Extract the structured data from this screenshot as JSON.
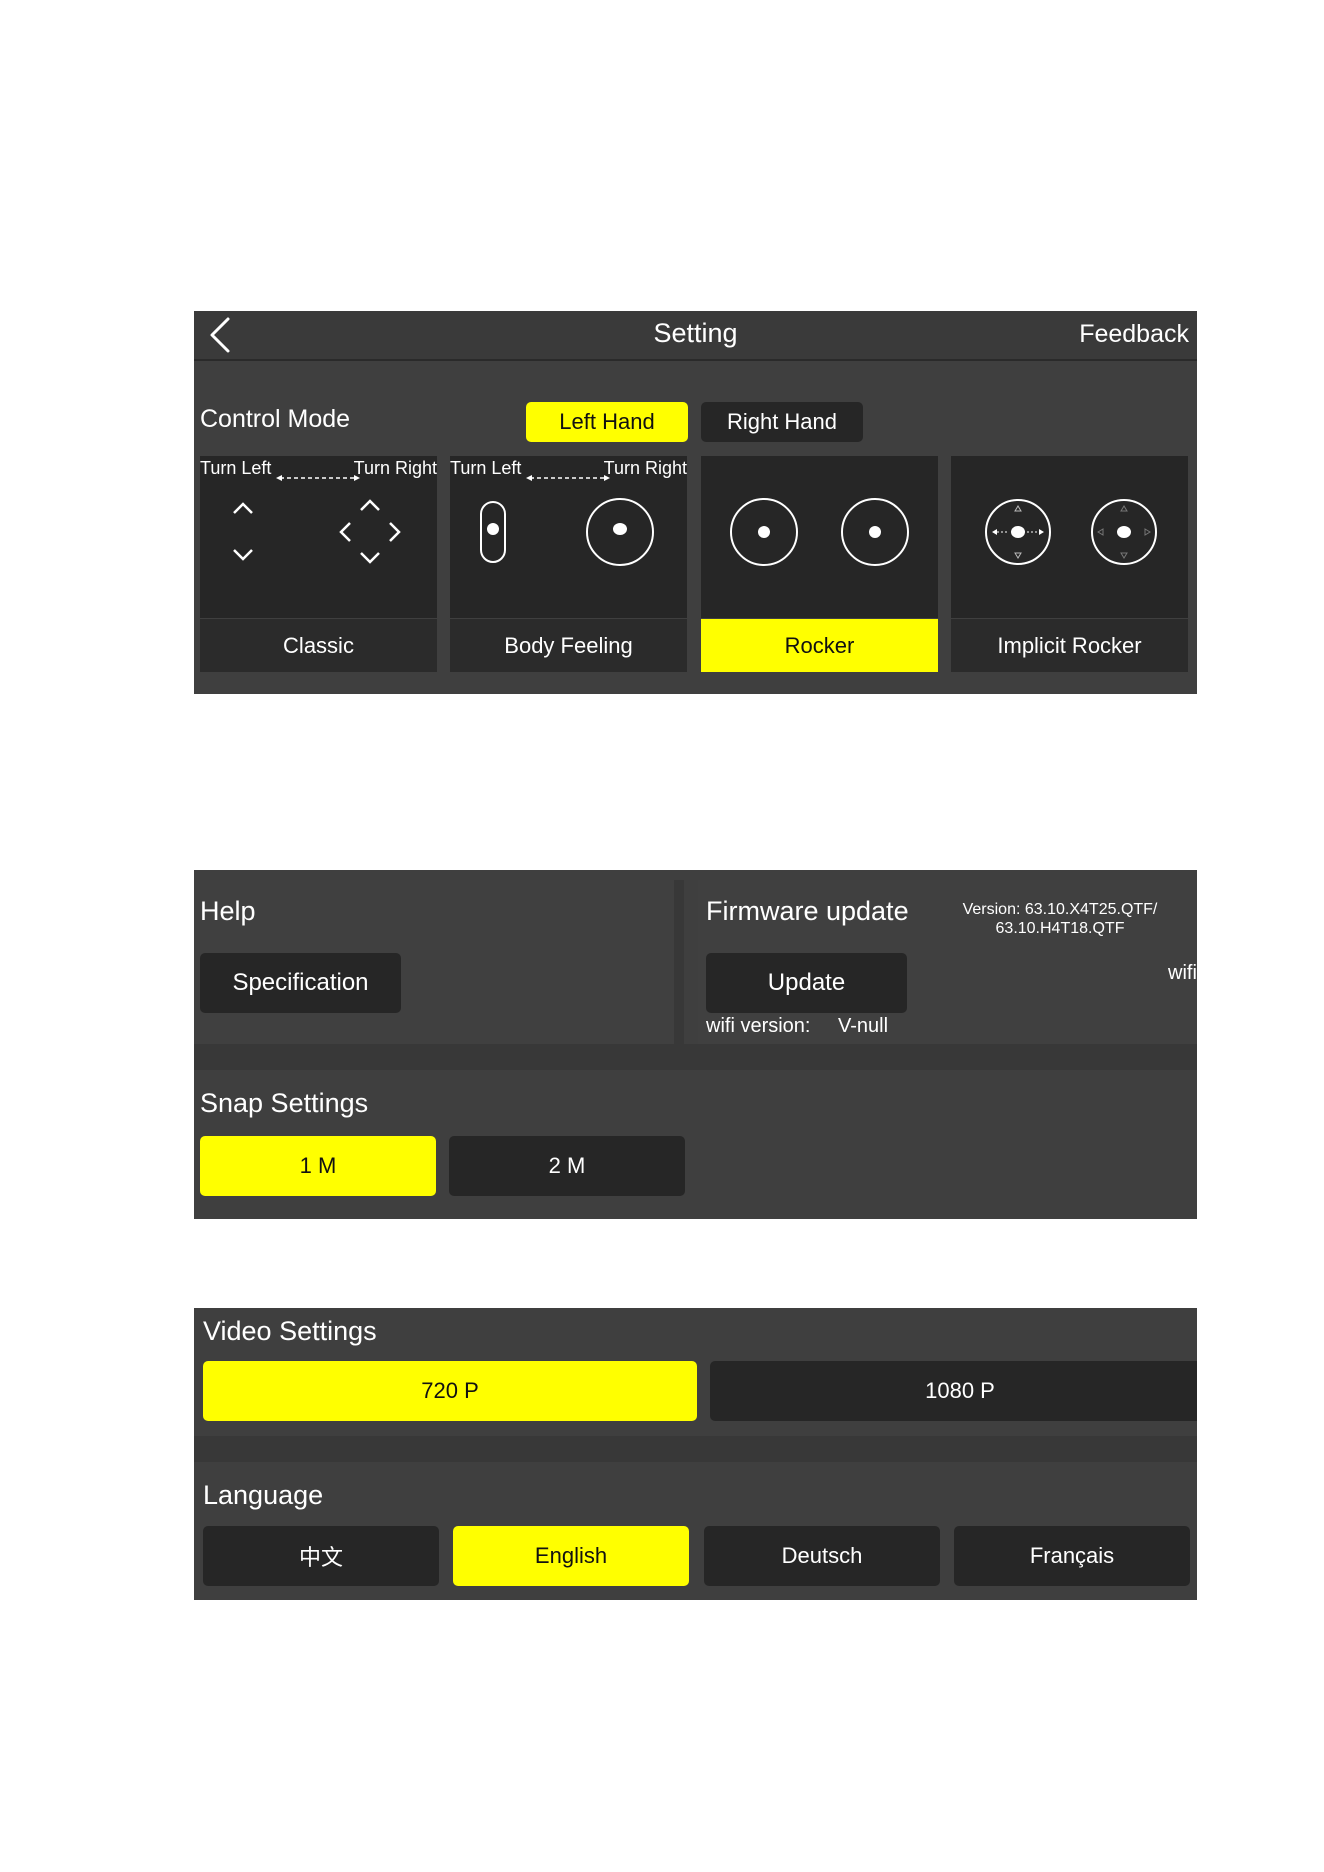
{
  "header": {
    "title": "Setting",
    "feedback_label": "Feedback",
    "back_icon": "chevron-left-icon"
  },
  "control_mode": {
    "title": "Control Mode",
    "hand_options": [
      {
        "label": "Left Hand",
        "selected": true
      },
      {
        "label": "Right Hand",
        "selected": false
      }
    ],
    "modes": [
      {
        "label": "Classic",
        "selected": false,
        "turn_left": "Turn Left",
        "turn_right": "Turn Right"
      },
      {
        "label": "Body Feeling",
        "selected": false,
        "turn_left": "Turn Left",
        "turn_right": "Turn Right"
      },
      {
        "label": "Rocker",
        "selected": true
      },
      {
        "label": "Implicit Rocker",
        "selected": false
      }
    ]
  },
  "help": {
    "title": "Help",
    "specification_label": "Specification"
  },
  "firmware": {
    "title": "Firmware update",
    "version_line1": "Version: 63.10.X4T25.QTF/",
    "version_line2": "63.10.H4T18.QTF",
    "update_label": "Update",
    "wifi_version_label": "wifi version:",
    "wifi_version_value": "V-null",
    "wifi_truncated": "wifi"
  },
  "snap": {
    "title": "Snap Settings",
    "options": [
      {
        "label": "1 M",
        "selected": true
      },
      {
        "label": "2 M",
        "selected": false
      }
    ]
  },
  "video": {
    "title": "Video Settings",
    "options": [
      {
        "label": "720 P",
        "selected": true
      },
      {
        "label": "1080 P",
        "selected": false
      }
    ]
  },
  "language": {
    "title": "Language",
    "options": [
      {
        "label": "中文",
        "selected": false
      },
      {
        "label": "English",
        "selected": true
      },
      {
        "label": "Deutsch",
        "selected": false
      },
      {
        "label": "Français",
        "selected": false
      }
    ]
  },
  "colors": {
    "panel_bg": "#3f3f3f",
    "button_bg": "#262626",
    "accent": "#ffff00"
  }
}
